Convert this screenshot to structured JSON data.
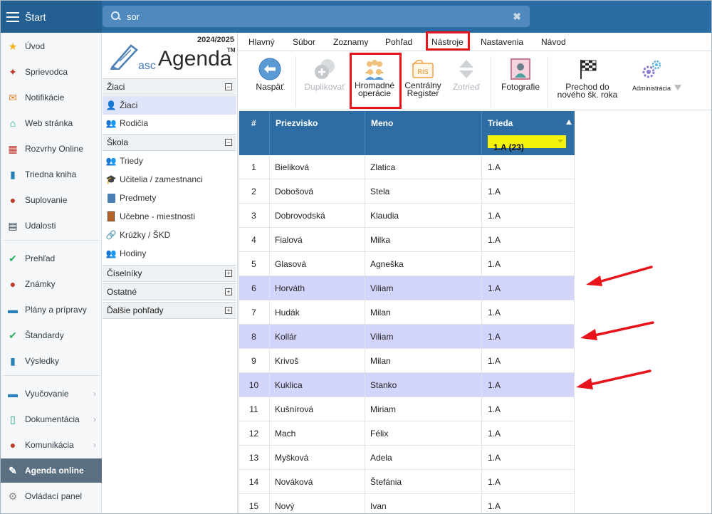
{
  "topbar": {
    "start_label": "Štart",
    "search_value": "sor",
    "clear_glyph": "✖"
  },
  "sidebar": {
    "items": [
      {
        "label": "Úvod",
        "icon": "star-icon",
        "color": "#f2b01e"
      },
      {
        "label": "Sprievodca",
        "icon": "magic-wand-icon",
        "color": "#c0392b"
      },
      {
        "label": "Notifikácie",
        "icon": "envelope-icon",
        "color": "#e67e22"
      },
      {
        "label": "Web stránka",
        "icon": "home-icon",
        "color": "#16a085"
      },
      {
        "label": "Rozvrhy Online",
        "icon": "timetable-icon",
        "color": "#c0392b"
      },
      {
        "label": "Triedna kniha",
        "icon": "book-icon",
        "color": "#2980b9"
      },
      {
        "label": "Suplovanie",
        "icon": "substitution-icon",
        "color": "#c0392b"
      },
      {
        "label": "Udalosti",
        "icon": "calendar-icon",
        "color": "#2c3e50"
      },
      {
        "label": "Prehľad",
        "icon": "check-circle-icon",
        "color": "#27ae60"
      },
      {
        "label": "Známky",
        "icon": "grades-icon",
        "color": "#c0392b"
      },
      {
        "label": "Plány a prípravy",
        "icon": "briefcase-icon",
        "color": "#2980b9"
      },
      {
        "label": "Štandardy",
        "icon": "shield-icon",
        "color": "#27ae60"
      },
      {
        "label": "Výsledky",
        "icon": "bar-chart-icon",
        "color": "#2980b9"
      },
      {
        "label": "Vyučovanie",
        "icon": "open-book-icon",
        "color": "#2980b9"
      },
      {
        "label": "Dokumentácia",
        "icon": "document-icon",
        "color": "#16a085"
      },
      {
        "label": "Komunikácia",
        "icon": "chat-icon",
        "color": "#c0392b"
      },
      {
        "label": "Agenda online",
        "icon": "pen-icon",
        "color": "#ffffff"
      },
      {
        "label": "Ovládací panel",
        "icon": "gear-icon",
        "color": "#888888"
      }
    ]
  },
  "col2": {
    "year": "2024/2025",
    "logo_asc": "asc",
    "logo_agenda": "Agenda",
    "logo_tm": "TM",
    "groups": {
      "ziaci": "Žiaci",
      "skola": "Škola",
      "ciselniky": "Číselníky",
      "ostatne": "Ostatné",
      "dalsie": "Ďalšie pohľady"
    },
    "ziaci_items": [
      "Žiaci",
      "Rodičia"
    ],
    "skola_items": [
      "Triedy",
      "Učitelia / zamestnanci",
      "Predmety",
      "Učebne - miestnosti",
      "Krúžky / ŠKD",
      "Hodiny"
    ],
    "toggle_minus": "−",
    "toggle_plus": "+"
  },
  "menubar": [
    "Hlavný",
    "Súbor",
    "Zoznamy",
    "Pohľad",
    "Nástroje",
    "Nastavenia",
    "Návod"
  ],
  "toolbar": {
    "back": "Naspäť",
    "duplicate": "Duplikovať",
    "bulk_1": "Hromadné",
    "bulk_2": "operácie",
    "central_1": "Centrálny",
    "central_2": "Register",
    "central_icon_text": "RIS",
    "sort": "Zotrieď",
    "photos": "Fotografie",
    "transition_1": "Prechod do",
    "transition_2": "nového šk. roka",
    "admin": "Administrácia"
  },
  "table": {
    "headers": [
      "#",
      "Priezvisko",
      "Meno",
      "Trieda"
    ],
    "class_filter": "1.A (23)",
    "rows": [
      [
        "1",
        "Bieliková",
        "Zlatica",
        "1.A"
      ],
      [
        "2",
        "Dobošová",
        "Stela",
        "1.A"
      ],
      [
        "3",
        "Dobrovodská",
        "Klaudia",
        "1.A"
      ],
      [
        "4",
        "Fialová",
        "Milka",
        "1.A"
      ],
      [
        "5",
        "Glasová",
        "Agneška",
        "1.A"
      ],
      [
        "6",
        "Horváth",
        "Viliam",
        "1.A"
      ],
      [
        "7",
        "Hudák",
        "Milan",
        "1.A"
      ],
      [
        "8",
        "Kollár",
        "Viliam",
        "1.A"
      ],
      [
        "9",
        "Krivoš",
        "Milan",
        "1.A"
      ],
      [
        "10",
        "Kuklica",
        "Stanko",
        "1.A"
      ],
      [
        "11",
        "Kušnírová",
        "Miriam",
        "1.A"
      ],
      [
        "12",
        "Mach",
        "Félix",
        "1.A"
      ],
      [
        "13",
        "Myšková",
        "Adela",
        "1.A"
      ],
      [
        "14",
        "Nováková",
        "Štefánia",
        "1.A"
      ],
      [
        "15",
        "Nový",
        "Ivan",
        "1.A"
      ]
    ],
    "highlighted_rows": [
      6,
      8,
      10
    ]
  },
  "colors": {
    "topbar": "#2b6ca3",
    "header": "#2e6da4",
    "highlight": "#d3d4fb",
    "annotation": "#e8141b",
    "filter": "#f2f20c"
  }
}
